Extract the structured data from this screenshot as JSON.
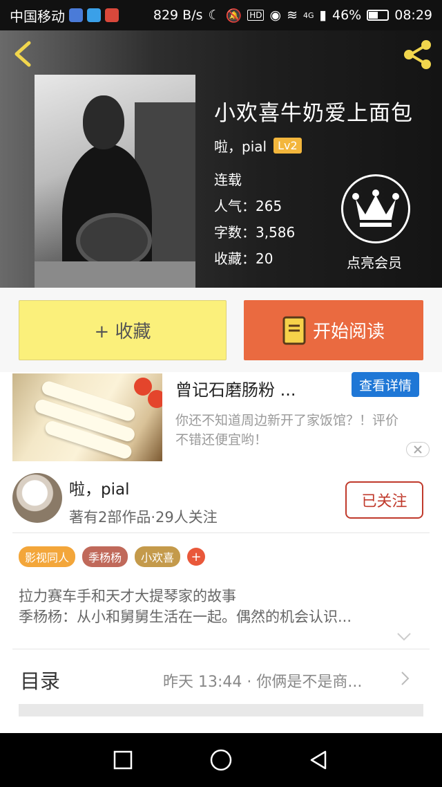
{
  "status_bar": {
    "carrier": "中国移动",
    "net_speed": "829 B/s",
    "battery": "46%",
    "time": "08:29",
    "hd_label": "HD",
    "network": "4G"
  },
  "book": {
    "title": "小欢喜牛奶爱上面包",
    "author": "啦，pial",
    "level": "Lv2",
    "status": "连载",
    "popularity": "人气：265",
    "word_count": "字数：3,586",
    "favorites": "收藏：20",
    "vip_label": "点亮会员"
  },
  "actions": {
    "collect": "+ 收藏",
    "read": "开始阅读"
  },
  "ad": {
    "title": "曾记石磨肠粉 ...",
    "detail_button": "查看详情",
    "description": "你还不知道周边新开了家饭馆？！评价不错还便宜哟！"
  },
  "author_card": {
    "name": "啦，pial",
    "stats": "著有2部作品·29人关注",
    "follow_button": "已关注"
  },
  "tags": [
    {
      "label": "影视同人",
      "color": "#f3a63a"
    },
    {
      "label": "季杨杨",
      "color": "#c0695a"
    },
    {
      "label": "小欢喜",
      "color": "#c49a4b"
    }
  ],
  "tag_add": "+",
  "synopsis": "拉力赛车手和天才大提琴家的故事\n季杨杨：从小和舅舅生活在一起。偶然的机会认识...",
  "toc": {
    "title": "目录",
    "latest": "昨天 13:44 · 你俩是不是商..."
  },
  "colors": {
    "collect_bg": "#fbf07b",
    "read_bg": "#ea6a40",
    "follow": "#c0392b",
    "ad_button": "#1f77d6"
  }
}
